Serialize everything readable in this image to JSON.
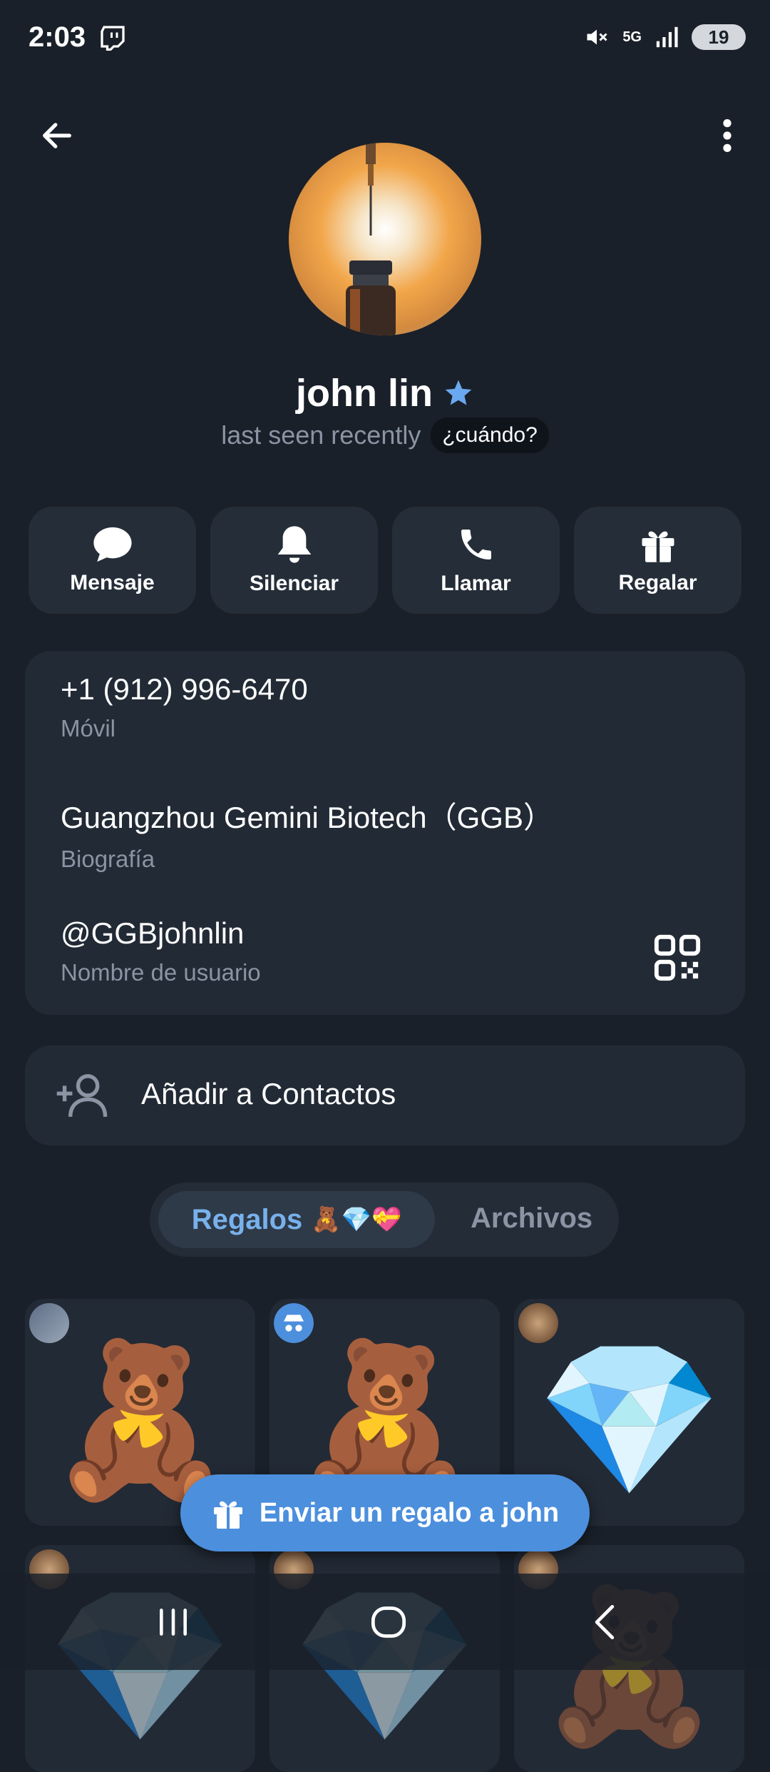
{
  "status_bar": {
    "time": "2:03",
    "network": "5G",
    "battery": "19"
  },
  "profile": {
    "name": "john lin",
    "last_seen": "last seen recently",
    "when_label": "¿cuándo?"
  },
  "actions": [
    {
      "label": "Mensaje",
      "icon": "message-icon"
    },
    {
      "label": "Silenciar",
      "icon": "bell-icon"
    },
    {
      "label": "Llamar",
      "icon": "phone-icon"
    },
    {
      "label": "Regalar",
      "icon": "gift-icon"
    }
  ],
  "info": {
    "phone": "+1 (912) 996-6470",
    "phone_label": "Móvil",
    "bio": "Guangzhou Gemini Biotech（GGB）",
    "bio_label": "Biografía",
    "username": "@GGBjohnlin",
    "username_label": "Nombre de usuario"
  },
  "add_contact": {
    "label": "Añadir a Contactos"
  },
  "tabs": {
    "gifts": "Regalos",
    "gifts_emojis": "🧸💎💝",
    "files": "Archivos"
  },
  "gifts": [
    {
      "item": "🧸"
    },
    {
      "item": "🧸"
    },
    {
      "item": "💎"
    },
    {
      "item": "💎"
    },
    {
      "item": "💎"
    },
    {
      "item": "🧸"
    }
  ],
  "send_gift_button": "Enviar un regalo a john",
  "colors": {
    "background": "#1a2029",
    "card": "#222a35",
    "accent": "#4c8fdd",
    "tab_active_text": "#78b1ec",
    "secondary_text": "#8a94a3"
  }
}
